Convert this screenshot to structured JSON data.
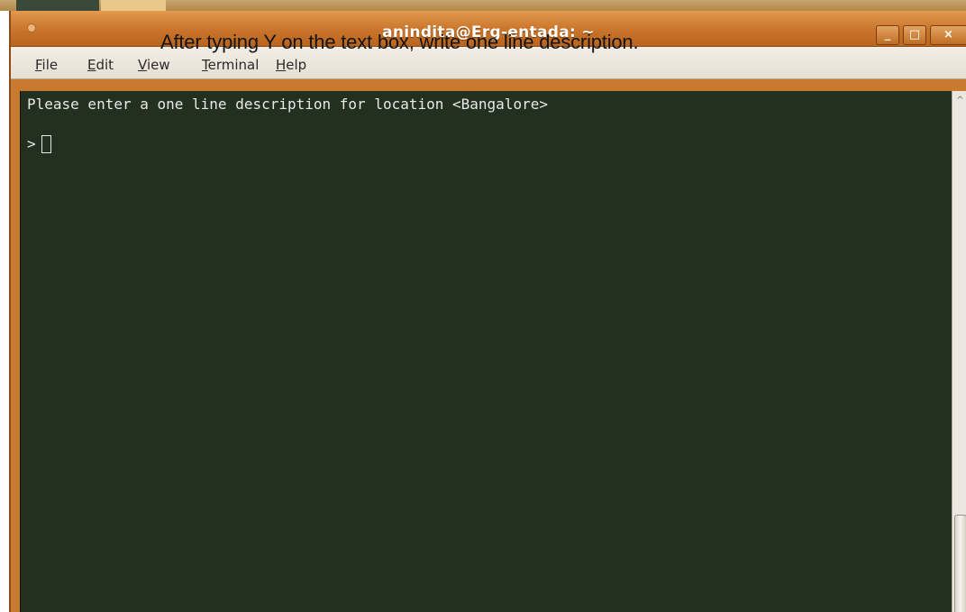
{
  "window": {
    "title": "anindita@Erg-entada: ~",
    "buttons": {
      "minimize": "_",
      "maximize": "□",
      "close": "×"
    }
  },
  "menubar": {
    "items": [
      {
        "mnemonic": "F",
        "rest": "ile"
      },
      {
        "mnemonic": "E",
        "rest": "dit"
      },
      {
        "mnemonic": "V",
        "rest": "iew"
      },
      {
        "mnemonic": "T",
        "rest": "erminal"
      },
      {
        "mnemonic": "H",
        "rest": "elp"
      }
    ]
  },
  "caption": "After typing Y on the text box, write one line description.",
  "terminal": {
    "lines": [
      "Please enter a one line description for location <Bangalore>"
    ],
    "prompt": ">",
    "input_value": ""
  },
  "colors": {
    "titlebar": "#c9742a",
    "terminal_background": "#24301f",
    "terminal_text": "#e9e9e9",
    "menubar": "#eee8df"
  },
  "icons": {
    "window_menu": "circle-dot-icon",
    "scroll_up": "chevron-up-icon"
  }
}
